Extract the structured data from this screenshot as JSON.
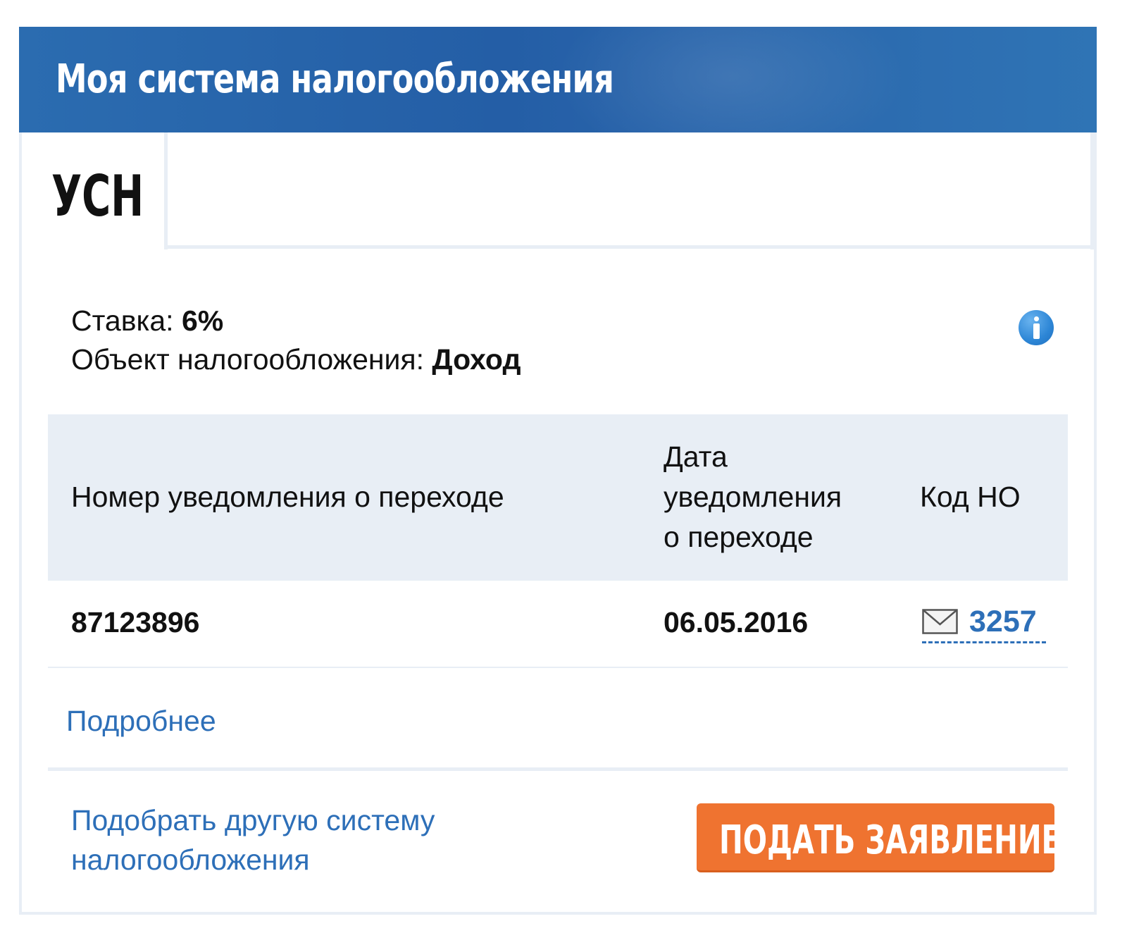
{
  "header": {
    "title": "Моя система налогообложения"
  },
  "tabs": [
    {
      "label": "УСН",
      "active": true
    }
  ],
  "info": {
    "rate_label": "Ставка: ",
    "rate_value": "6%",
    "object_label": "Объект налогообложения: ",
    "object_value": "Доход",
    "icon": "info-icon"
  },
  "table": {
    "columns": [
      "Номер уведомления о переходе",
      "Дата уведомления о переходе",
      "Код НО"
    ],
    "column_lines": {
      "date": [
        "Дата",
        "уведомления",
        "о переходе"
      ]
    },
    "rows": [
      {
        "number": "87123896",
        "date": "06.05.2016",
        "code": "3257",
        "code_icon": "envelope-icon"
      }
    ]
  },
  "more_link": "Подробнее",
  "footer": {
    "choose_link_lines": [
      "Подобрать другую систему",
      "налогообложения"
    ],
    "submit_label": "ПОДАТЬ ЗАЯВЛЕНИЕ"
  },
  "colors": {
    "header_blue": "#2b6cb0",
    "link_blue": "#2d6fb8",
    "button_orange": "#ef7330",
    "table_head_bg": "#e8eef5"
  }
}
